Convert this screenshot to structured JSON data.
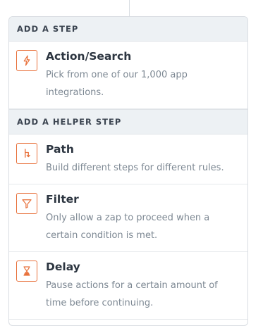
{
  "sections": [
    {
      "heading": "ADD A STEP",
      "items": [
        {
          "icon": "lightning-bolt-icon",
          "title": "Action/Search",
          "description": "Pick from one of our 1,000 app integrations."
        }
      ]
    },
    {
      "heading": "ADD A HELPER STEP",
      "items": [
        {
          "icon": "path-branch-icon",
          "title": "Path",
          "description": "Build different steps for different rules."
        },
        {
          "icon": "filter-funnel-icon",
          "title": "Filter",
          "description": "Only allow a zap to proceed when a certain condition is met."
        },
        {
          "icon": "hourglass-icon",
          "title": "Delay",
          "description": "Pause actions for a certain amount of time before continuing."
        }
      ]
    }
  ],
  "colors": {
    "accent": "#e8703a",
    "header_bg": "#edf1f4",
    "title": "#2c3540",
    "description": "#7d8893"
  }
}
